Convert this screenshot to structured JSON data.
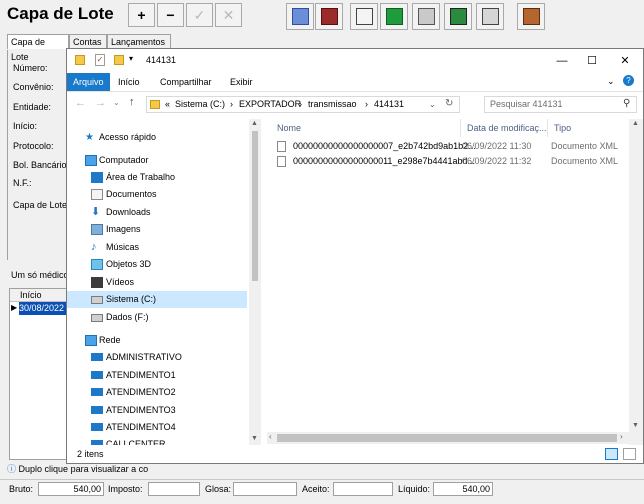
{
  "app": {
    "title": "Capa de Lote",
    "toolbar": {
      "add": "+",
      "remove": "−",
      "confirm": "✓",
      "cancel": "✕"
    },
    "tabs": [
      "Capa de Lote",
      "Contas",
      "Lançamentos"
    ],
    "labels": [
      "Número:",
      "Convênio:",
      "Entidade:",
      "Início:",
      "Protocolo:",
      "Bol. Bancário",
      "N.F.:",
      "Capa de Lote"
    ],
    "list_title": "Um só médico",
    "grid": {
      "header": "Início",
      "row_value": "30/08/2022"
    },
    "status_hint": "Duplo clique para visualizar a co",
    "footer": {
      "bruto_label": "Bruto:",
      "bruto_value": "540,00",
      "imposto_label": "Imposto:",
      "imposto_value": "",
      "glosa_label": "Glosa:",
      "glosa_value": "",
      "aceito_label": "Aceito:",
      "aceito_value": "",
      "liquido_label": "Líquido:",
      "liquido_value": "540,00"
    }
  },
  "explorer": {
    "title": "414131",
    "window_controls": {
      "minimize": "—",
      "maximize": "☐",
      "close": "✕"
    },
    "ribbon_tabs": [
      "Arquivo",
      "Início",
      "Compartilhar",
      "Exibir"
    ],
    "breadcrumb": [
      "«",
      "Sistema (C:)",
      "›",
      "EXPORTADOR",
      "›",
      "transmissao",
      "›",
      "414131"
    ],
    "search_placeholder": "Pesquisar 414131",
    "nav_items": [
      {
        "label": "Acesso rápido",
        "icon": "star-icon"
      },
      {
        "label": "Computador",
        "icon": "computer-icon"
      },
      {
        "label": "Área de Trabalho",
        "icon": "desktop-icon"
      },
      {
        "label": "Documentos",
        "icon": "documents-icon"
      },
      {
        "label": "Downloads",
        "icon": "download-icon"
      },
      {
        "label": "Imagens",
        "icon": "images-icon"
      },
      {
        "label": "Músicas",
        "icon": "music-icon"
      },
      {
        "label": "Objetos 3D",
        "icon": "cube-icon"
      },
      {
        "label": "Vídeos",
        "icon": "video-icon"
      },
      {
        "label": "Sistema (C:)",
        "icon": "drive-icon"
      },
      {
        "label": "Dados (F:)",
        "icon": "drive-icon"
      },
      {
        "label": "Rede",
        "icon": "network-icon"
      },
      {
        "label": "ADMINISTRATIVO",
        "icon": "monitor-icon"
      },
      {
        "label": "ATENDIMENTO1",
        "icon": "monitor-icon"
      },
      {
        "label": "ATENDIMENTO2",
        "icon": "monitor-icon"
      },
      {
        "label": "ATENDIMENTO3",
        "icon": "monitor-icon"
      },
      {
        "label": "ATENDIMENTO4",
        "icon": "monitor-icon"
      },
      {
        "label": "CALLCENTER",
        "icon": "monitor-icon"
      }
    ],
    "columns": [
      "Nome",
      "Data de modificaç...",
      "Tipo"
    ],
    "files": [
      {
        "name": "00000000000000000007_e2b742bd9ab1b2...",
        "modified": "06/09/2022 11:30",
        "type": "Documento XML"
      },
      {
        "name": "00000000000000000011_e298e7b4441abd...",
        "modified": "06/09/2022 11:32",
        "type": "Documento XML"
      }
    ],
    "status_count": "2 itens",
    "colors": {
      "accent": "#1979ca",
      "selection": "#cce8ff"
    }
  }
}
